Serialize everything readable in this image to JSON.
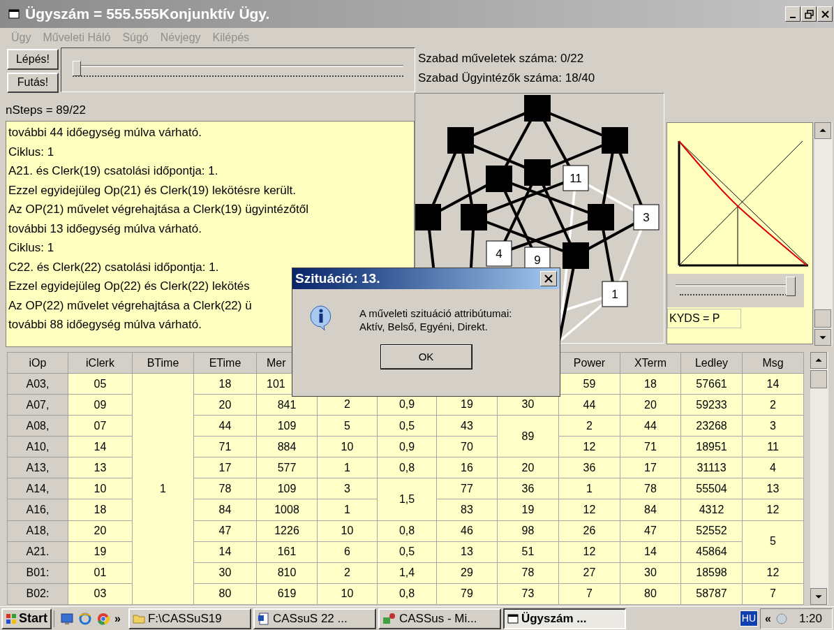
{
  "window": {
    "title": "Ügyszám = 555.555Konjunktív Ügy."
  },
  "menu": [
    {
      "label": "Ügy",
      "disabled": true
    },
    {
      "label": "Műveleti Háló",
      "disabled": true
    },
    {
      "label": "Súgó",
      "disabled": true
    },
    {
      "label": "Névjegy",
      "disabled": true
    },
    {
      "label": "Kilépés",
      "disabled": true
    }
  ],
  "buttons": [
    "Lépés!",
    "Futás!"
  ],
  "step_slider": {
    "level": 0
  },
  "stats": [
    "Szabad műveletek száma: 0/22",
    "Szabad Ügyintézők száma: 18/40"
  ],
  "nsteps": "nSteps = 89/22",
  "log": [
    "további 44 időegység múlva várható.",
    "Ciklus: 1",
    "A21. és Clerk(19) csatolási időpontja: 1.",
    "Ezzel egyidejüleg Op(21) és Clerk(19) lekötésre került.",
    "Az OP(21) művelet végrehajtása a Clerk(19) ügyintézőtől",
    "további 13 időegység múlva várható.",
    "Ciklus: 1",
    "C22. és Clerk(22) csatolási időpontja: 1.",
    "Ezzel egyidejüleg Op(22) és Clerk(22) lekötés",
    "Az OP(22) művelet végrehajtása a Clerk(22) ü",
    "további 88 időegység múlva várható."
  ],
  "network": {
    "labels": [
      "11",
      "3",
      "4",
      "9",
      "1"
    ]
  },
  "kyds_slider": {
    "level": 0.93
  },
  "kyds_field": {
    "value": "KYDS = P"
  },
  "table": {
    "columns": [
      "iOp",
      "iClerk",
      "BTime",
      "ETime",
      "Mer",
      null,
      null,
      null,
      null,
      "Power",
      "XTerm",
      "Ledley",
      "Msg"
    ],
    "rows": [
      [
        "A03,",
        "05",
        null,
        "18",
        "101",
        null,
        null,
        null,
        null,
        "59",
        "18",
        "57661",
        "14"
      ],
      [
        "A07,",
        "09",
        null,
        "20",
        "841",
        "2",
        "0,9",
        "19",
        "30",
        "44",
        "20",
        "59233",
        "2"
      ],
      [
        "A08,",
        "07",
        null,
        "44",
        "109",
        "5",
        "0,5",
        "43",
        {
          "text": "89",
          "merged": false
        },
        "2",
        "44",
        "23268",
        "3"
      ],
      [
        "A10,",
        "14",
        null,
        "71",
        "884",
        "10",
        "0,9",
        "70",
        {
          "merged": true
        },
        "12",
        "71",
        "18951",
        "11"
      ],
      [
        "A13,",
        "13",
        null,
        "17",
        "577",
        "1",
        "0,8",
        "16",
        "20",
        "36",
        "17",
        "31113",
        "4"
      ],
      [
        "A14,",
        "10",
        "1",
        "78",
        "109",
        "3",
        {
          "text": "1,5",
          "merged": false
        },
        "77",
        "36",
        "1",
        "78",
        "55504",
        "13"
      ],
      [
        "A16,",
        "18",
        null,
        "84",
        "1008",
        "1",
        {
          "merged": true
        },
        "83",
        "19",
        "12",
        "84",
        "4312",
        "12"
      ],
      [
        "A18,",
        "20",
        null,
        "47",
        "1226",
        "10",
        "0,8",
        "46",
        "98",
        "26",
        "47",
        "52552",
        {
          "text": "5",
          "merged": false
        }
      ],
      [
        "A21.",
        "19",
        null,
        "14",
        "161",
        "6",
        "0,5",
        "13",
        "51",
        "12",
        "14",
        "45864",
        {
          "merged": true
        }
      ],
      [
        "B01:",
        "01",
        null,
        "30",
        "810",
        "2",
        "1,4",
        "29",
        "78",
        "27",
        "30",
        "18598",
        "12"
      ],
      [
        "B02:",
        "03",
        null,
        "80",
        "619",
        "10",
        "0,8",
        "79",
        "73",
        "7",
        "80",
        "58787",
        "7"
      ]
    ]
  },
  "dialog": {
    "title": "Szituáció: 13.",
    "message": "A műveleti szituáció attribútumai:\nAktív, Belső, Egyéni, Direkt.",
    "button": "OK"
  },
  "taskbar": {
    "start": "Start",
    "more": "»",
    "tasks": [
      {
        "label": "F:\\CASSuS19",
        "kind": "folder",
        "selected": false
      },
      {
        "label": "CASsuS 22 ...",
        "kind": "document",
        "selected": false
      },
      {
        "label": "CASSus - Mi...",
        "kind": "app",
        "selected": false
      },
      {
        "label": "Ügyszám ...",
        "kind": "window",
        "selected": true
      }
    ],
    "language": "HU",
    "expand": "«",
    "clock": "1:20"
  }
}
